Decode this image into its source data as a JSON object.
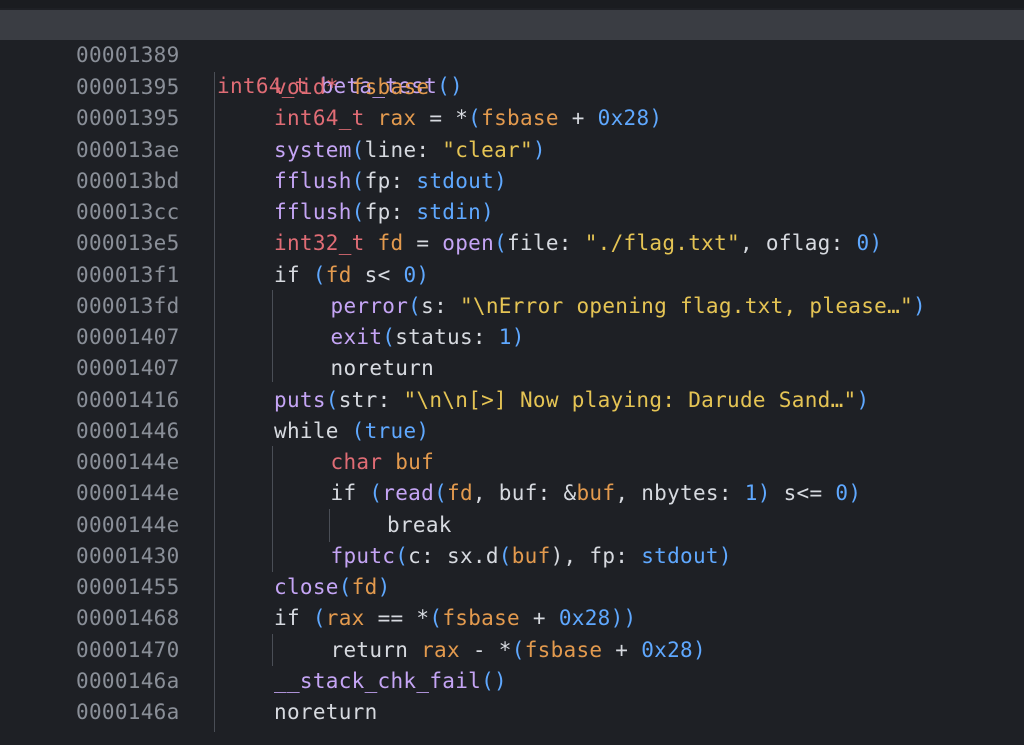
{
  "header": {
    "address": "00001389",
    "return_type": "int64_t",
    "func_name": "beta_test",
    "parens": "()"
  },
  "lines": [
    {
      "addr": "00001395",
      "t": [
        "void* ",
        "fsbase"
      ]
    },
    {
      "addr": "00001395",
      "t": [
        "int64_t ",
        "rax",
        " = *",
        "(",
        "fsbase",
        " + ",
        "0x28",
        ")"
      ]
    },
    {
      "addr": "000013ae",
      "t": [
        "system",
        "(",
        "line: ",
        "\"clear\"",
        ")"
      ]
    },
    {
      "addr": "000013bd",
      "t": [
        "fflush",
        "(",
        "fp: ",
        "stdout",
        ")"
      ]
    },
    {
      "addr": "000013cc",
      "t": [
        "fflush",
        "(",
        "fp: ",
        "stdin",
        ")"
      ]
    },
    {
      "addr": "000013e5",
      "t": [
        "int32_t ",
        "fd",
        " = ",
        "open",
        "(",
        "file: ",
        "\"./flag.txt\"",
        ", oflag: ",
        "0",
        ")"
      ]
    },
    {
      "addr": "000013f1",
      "t": [
        "if ",
        "(",
        "fd",
        " s< ",
        "0",
        ")"
      ]
    },
    {
      "addr": "000013fd",
      "t": [
        "perror",
        "(",
        "s: ",
        "\"\\nError opening flag.txt, please…\"",
        ")"
      ]
    },
    {
      "addr": "00001407",
      "t": [
        "exit",
        "(",
        "status: ",
        "1",
        ")"
      ]
    },
    {
      "addr": "00001407",
      "t": [
        "noreturn"
      ]
    },
    {
      "addr": "00001416",
      "t": [
        "puts",
        "(",
        "str: ",
        "\"\\n\\n[>] Now playing: Darude Sand…\"",
        ")"
      ]
    },
    {
      "addr": "00001446",
      "t": [
        "while ",
        "(",
        "true",
        ")"
      ]
    },
    {
      "addr": "0000144e",
      "t": [
        "char ",
        "buf"
      ]
    },
    {
      "addr": "0000144e",
      "t": [
        "if ",
        "(",
        "read",
        "(",
        "fd",
        ", buf: &",
        "buf",
        ", nbytes: ",
        "1",
        ")",
        " s<= ",
        "0",
        ")"
      ]
    },
    {
      "addr": "0000144e",
      "t": [
        "break"
      ]
    },
    {
      "addr": "00001430",
      "t": [
        "fputc",
        "(",
        "c: sx.d",
        "(",
        "buf",
        "), fp: ",
        "stdout",
        ")"
      ]
    },
    {
      "addr": "00001455",
      "t": [
        "close",
        "(",
        "fd",
        ")"
      ]
    },
    {
      "addr": "00001468",
      "t": [
        "if ",
        "(",
        "rax",
        " == *",
        "(",
        "fsbase",
        " + ",
        "0x28",
        "))"
      ]
    },
    {
      "addr": "00001470",
      "t": [
        "return ",
        "rax",
        " - *",
        "(",
        "fsbase",
        " + ",
        "0x28",
        ")"
      ]
    },
    {
      "addr": "0000146a",
      "t": [
        "__stack_chk_fail",
        "()"
      ]
    },
    {
      "addr": "0000146a",
      "t": [
        "noreturn"
      ]
    }
  ]
}
